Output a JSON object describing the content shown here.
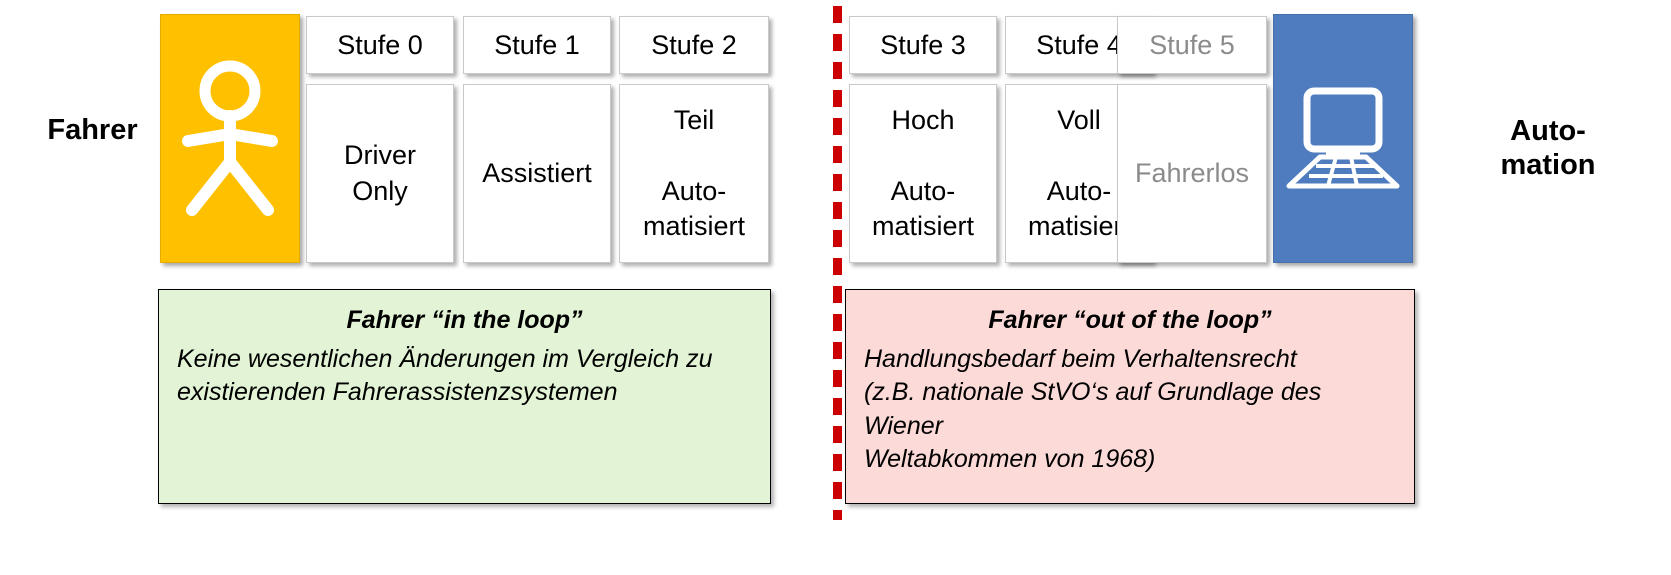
{
  "labels": {
    "left": "Fahrer",
    "right": "Auto-\nmation"
  },
  "icons": {
    "left_icon": "pedestrian-stick-figure-icon",
    "right_icon": "laptop-computer-icon"
  },
  "colors": {
    "driver_panel": "#FFC000",
    "automation_panel": "#4F7CBF",
    "divider": "#CC0000",
    "note_left_bg": "#E2F4D5",
    "note_right_bg": "#FBDAD7",
    "dim_text": "#8B8B8B"
  },
  "levels": [
    {
      "head": "Stufe 0",
      "body": "Driver\nOnly",
      "dim": false
    },
    {
      "head": "Stufe 1",
      "body": "Assistiert",
      "dim": false
    },
    {
      "head": "Stufe 2",
      "body": "Teil\n\nAuto-\nmatisiert",
      "dim": false
    },
    {
      "head": "Stufe 3",
      "body": "Hoch\n\nAuto-\nmatisiert",
      "dim": false
    },
    {
      "head": "Stufe 4",
      "body": "Voll\n\nAuto-\nmatisiert",
      "dim": false
    },
    {
      "head": "Stufe 5",
      "body": "Fahrerlos",
      "dim": true
    }
  ],
  "notes": {
    "left": {
      "title": "Fahrer “in the loop”",
      "body": "Keine wesentlichen Änderungen im Vergleich zu\nexistierenden Fahrerassistenzsystemen"
    },
    "right": {
      "title": "Fahrer “out of the loop”",
      "body": "Handlungsbedarf beim Verhaltensrecht\n(z.B. nationale StVO‘s auf Grundlage des Wiener\nWeltabkommen von 1968)"
    }
  }
}
